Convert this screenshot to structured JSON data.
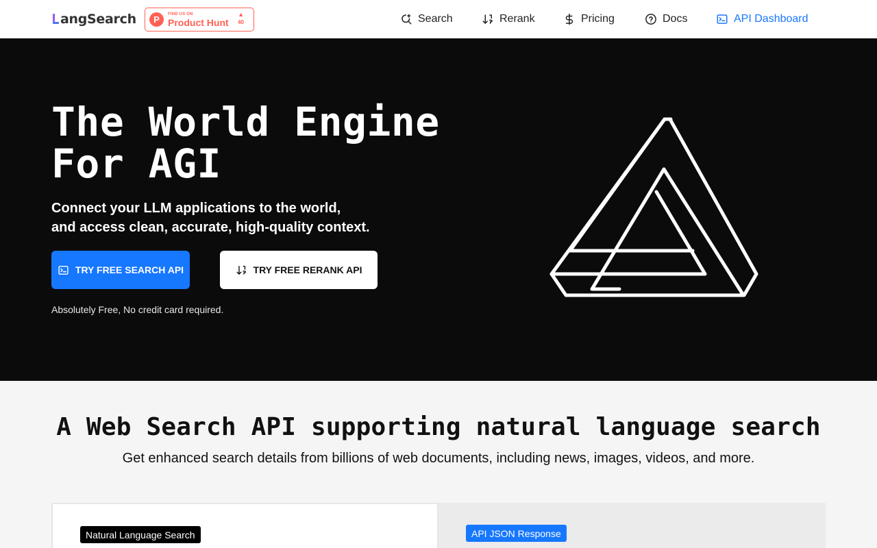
{
  "header": {
    "logo_text": "angSearch",
    "product_hunt": {
      "small": "FIND US ON",
      "big": "Product Hunt",
      "votes": "40"
    },
    "nav": [
      {
        "label": "Search",
        "icon": "search-sparkle-icon"
      },
      {
        "label": "Rerank",
        "icon": "sort-arrows-icon"
      },
      {
        "label": "Pricing",
        "icon": "dollar-icon"
      },
      {
        "label": "Docs",
        "icon": "question-circle-icon"
      },
      {
        "label": "API Dashboard",
        "icon": "terminal-icon",
        "active": true
      }
    ]
  },
  "hero": {
    "title": "The World Engine\nFor AGI",
    "subtitle_line1": "Connect your LLM applications to the world,",
    "subtitle_line2": "and access clean, accurate, high-quality context.",
    "primary_button": "TRY FREE SEARCH API",
    "secondary_button": "TRY FREE RERANK API",
    "note": "Absolutely Free, No credit card required."
  },
  "section": {
    "title": "A Web Search API supporting natural language search",
    "subtitle": "Get enhanced search details from billions of web documents, including news, images, videos, and more.",
    "left_tag": "Natural Language Search",
    "right_tag": "API JSON Response"
  },
  "colors": {
    "accent": "#1677ff",
    "hero_bg": "#0b0b0c",
    "product_hunt": "#ff6154"
  }
}
